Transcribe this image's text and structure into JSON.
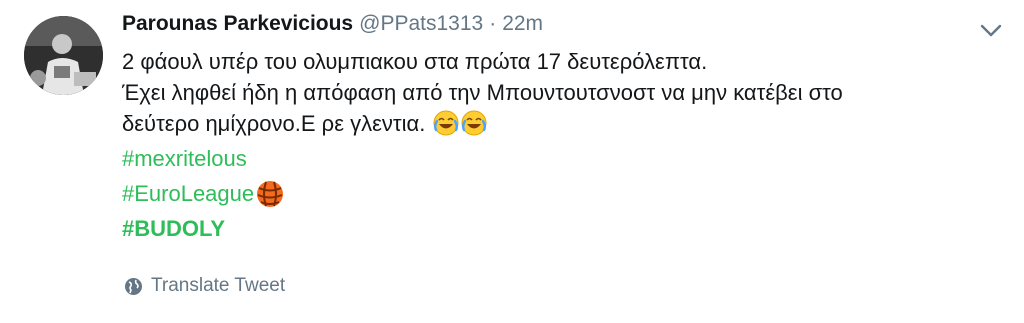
{
  "tweet": {
    "author_name": "Parounas Parkevicious",
    "handle": "@PPats1313",
    "separator": "·",
    "time": "22m",
    "text_lines": [
      "2 φάουλ υπέρ του ολυμπιακου στα πρώτα 17 δευτερόλεπτα.",
      "Έχει ληφθεί ήδη η απόφαση από την Μπουντουτσνοστ να μην κατέβει στο",
      "δεύτερο ημίχρονο.Ε ρε γλεντια."
    ],
    "emojis": [
      "face-with-tears-of-joy",
      "face-with-tears-of-joy"
    ],
    "hashtags": [
      "#mexritelous",
      "#EuroLeague",
      "#BUDOLY"
    ],
    "translate_label": "Translate Tweet"
  },
  "colors": {
    "hashtag": "#2ebd59",
    "secondary_text": "#657786",
    "primary_text": "#14171a",
    "euroleague_orange": "#f26b1f"
  },
  "icons": {
    "caret": "chevron-down-icon",
    "translate": "globe-icon",
    "euroleague": "euroleague-logo"
  }
}
